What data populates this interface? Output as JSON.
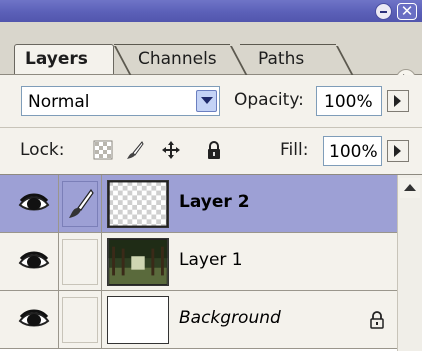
{
  "window": {
    "minimize_icon": "minimize-icon",
    "close_label": "✕"
  },
  "tabs": [
    {
      "label": "Layers",
      "active": true
    },
    {
      "label": "Channels",
      "active": false
    },
    {
      "label": "Paths",
      "active": false
    }
  ],
  "panel_menu_icon": "▶",
  "blend": {
    "mode": "Normal",
    "opacity_label": "Opacity:",
    "opacity_value": "100%"
  },
  "lock": {
    "label": "Lock:",
    "icons": [
      "lock-transparency-icon",
      "lock-image-icon",
      "lock-position-icon",
      "lock-all-icon"
    ],
    "fill_label": "Fill:",
    "fill_value": "100%"
  },
  "layers": [
    {
      "name": "Layer 2",
      "visible": true,
      "selected": true,
      "linked_brush": true,
      "thumbnail": "transparent"
    },
    {
      "name": "Layer 1",
      "visible": true,
      "selected": false,
      "linked_brush": false,
      "thumbnail": "photo-trees"
    },
    {
      "name": "Background",
      "visible": true,
      "selected": false,
      "linked_brush": false,
      "thumbnail": "white",
      "locked": true
    }
  ],
  "colors": {
    "title_bar": "#5b60b8",
    "selected_row": "#9da0d5",
    "panel_bg": "#f4f2ec"
  }
}
